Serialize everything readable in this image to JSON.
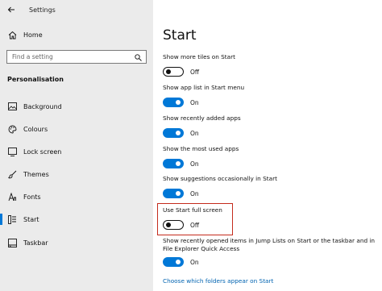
{
  "window": {
    "title": "Settings"
  },
  "sidebar": {
    "home_label": "Home",
    "search_placeholder": "Find a setting",
    "section_label": "Personalisation",
    "items": [
      {
        "label": "Background",
        "icon": "image-icon"
      },
      {
        "label": "Colours",
        "icon": "palette-icon"
      },
      {
        "label": "Lock screen",
        "icon": "lock-screen-icon"
      },
      {
        "label": "Themes",
        "icon": "brush-icon"
      },
      {
        "label": "Fonts",
        "icon": "font-icon"
      },
      {
        "label": "Start",
        "icon": "start-icon",
        "active": true
      },
      {
        "label": "Taskbar",
        "icon": "taskbar-icon"
      }
    ]
  },
  "main": {
    "title": "Start",
    "settings": [
      {
        "label": "Show more tiles on Start",
        "state": "Off"
      },
      {
        "label": "Show app list in Start menu",
        "state": "On"
      },
      {
        "label": "Show recently added apps",
        "state": "On"
      },
      {
        "label": "Show the most used apps",
        "state": "On"
      },
      {
        "label": "Show suggestions occasionally in Start",
        "state": "On"
      },
      {
        "label": "Use Start full screen",
        "state": "Off",
        "highlighted": true
      },
      {
        "label": "Show recently opened items in Jump Lists on Start or the taskbar and in File Explorer Quick Access",
        "state": "On"
      }
    ],
    "link_text": "Choose which folders appear on Start"
  },
  "colors": {
    "accent": "#0078d7",
    "highlight_border": "#c42b1c",
    "sidebar_bg": "#ebebeb",
    "link": "#0063b1"
  }
}
